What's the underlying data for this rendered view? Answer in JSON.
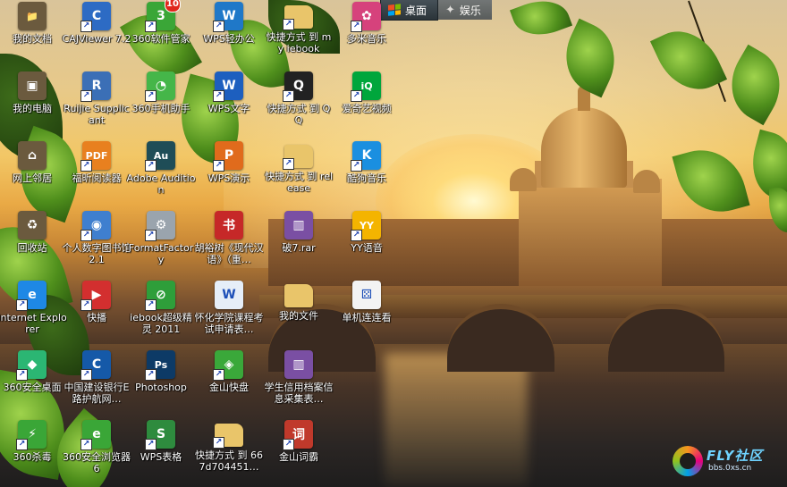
{
  "tabs": [
    {
      "label": "桌面",
      "active": true,
      "icon": "windows-flag-icon"
    },
    {
      "label": "娱乐",
      "active": false,
      "icon": "star-icon"
    }
  ],
  "icons": [
    {
      "label": "我的文档",
      "icon": "my-documents-icon",
      "color": "#6b5a3e"
    },
    {
      "label": "CAJViewer 7.2",
      "icon": "cajviewer-icon",
      "color": "#2d6bc4"
    },
    {
      "label": "360软件管家",
      "icon": "360-software-manager-icon",
      "color": "#3aa637",
      "badge": "10"
    },
    {
      "label": "WPS轻办公",
      "icon": "wps-light-office-icon",
      "color": "#1f78c8"
    },
    {
      "label": "快捷方式 到 my iebook",
      "icon": "folder-shortcut-icon",
      "color": "#e9c56a"
    },
    {
      "label": "多米音乐",
      "icon": "duomi-music-icon",
      "color": "#d6427c"
    },
    {
      "label": "我的电脑",
      "icon": "my-computer-icon",
      "color": "#6b5a3e"
    },
    {
      "label": "Ruijie Supplicant",
      "icon": "ruijie-supplicant-icon",
      "color": "#3b6fb6"
    },
    {
      "label": "360手机助手",
      "icon": "360-phone-assistant-icon",
      "color": "#45b649"
    },
    {
      "label": "WPS文字",
      "icon": "wps-writer-icon",
      "color": "#1d5fbf"
    },
    {
      "label": "快捷方式 到 QQ",
      "icon": "qq-penguin-icon",
      "color": "#222222"
    },
    {
      "label": "爱奇艺视频",
      "icon": "iqiyi-icon",
      "color": "#00a63c"
    },
    {
      "label": "网上邻居",
      "icon": "network-neighborhood-icon",
      "color": "#6b5a3e"
    },
    {
      "label": "福昕阅读器",
      "icon": "foxit-reader-icon",
      "color": "#e8801f"
    },
    {
      "label": "Adobe Audition",
      "icon": "adobe-audition-icon",
      "color": "#1f4d57"
    },
    {
      "label": "WPS演示",
      "icon": "wps-presentation-icon",
      "color": "#e06b1c"
    },
    {
      "label": "快捷方式 到 release",
      "icon": "folder-shortcut-icon",
      "color": "#e9c56a"
    },
    {
      "label": "酷狗音乐",
      "icon": "kugou-music-icon",
      "color": "#1a8fe0"
    },
    {
      "label": "回收站",
      "icon": "recycle-bin-icon",
      "color": "#6b5a3e"
    },
    {
      "label": "个人数字图书馆2.1",
      "icon": "digital-library-icon",
      "color": "#3f7fcf"
    },
    {
      "label": "FormatFactory",
      "icon": "format-factory-icon",
      "color": "#9aa4ad"
    },
    {
      "label": "胡裕树《现代汉语》（重…",
      "icon": "book-icon",
      "color": "#c62828"
    },
    {
      "label": "破7.rar",
      "icon": "winrar-archive-icon",
      "color": "#7a4fa3"
    },
    {
      "label": "YY语音",
      "icon": "yy-voice-icon",
      "color": "#f4b400"
    },
    {
      "label": "Internet Explorer",
      "icon": "internet-explorer-icon",
      "color": "#1e88e5"
    },
    {
      "label": "快播",
      "icon": "qvod-player-icon",
      "color": "#d32f2f"
    },
    {
      "label": "iebook超级精灵 2011",
      "icon": "iebook-icon",
      "color": "#2e9e3a"
    },
    {
      "label": "怀化学院课程考试申请表…",
      "icon": "word-document-icon",
      "color": "#e6eef8"
    },
    {
      "label": "我的文件",
      "icon": "folder-icon",
      "color": "#e9c56a"
    },
    {
      "label": "单机连连看",
      "icon": "lianliankan-game-icon",
      "color": "#f3f3f3"
    },
    {
      "label": "360安全桌面",
      "icon": "360-safe-desktop-icon",
      "color": "#2bb673"
    },
    {
      "label": "中国建设银行E路护航网…",
      "icon": "ccb-bank-icon",
      "color": "#1559a8"
    },
    {
      "label": "Photoshop",
      "icon": "photoshop-icon",
      "color": "#0d3a66"
    },
    {
      "label": "金山快盘",
      "icon": "kingsoft-kuaipan-icon",
      "color": "#3aa83a"
    },
    {
      "label": "学生信用档案信息采集表…",
      "icon": "winrar-archive-icon",
      "color": "#7a4fa3"
    },
    {
      "label": "360杀毒",
      "icon": "360-antivirus-icon",
      "color": "#3aa637"
    },
    {
      "label": "360安全浏览器6",
      "icon": "360-browser-icon",
      "color": "#3aa637"
    },
    {
      "label": "WPS表格",
      "icon": "wps-spreadsheet-icon",
      "color": "#2e8b3e"
    },
    {
      "label": "快捷方式 到 667d704451…",
      "icon": "folder-shortcut-icon",
      "color": "#e9c56a"
    },
    {
      "label": "金山词霸",
      "icon": "kingsoft-powerword-icon",
      "color": "#c0392b"
    }
  ],
  "logo": {
    "name": "FLY社区",
    "url": "bbs.0xs.cn"
  }
}
